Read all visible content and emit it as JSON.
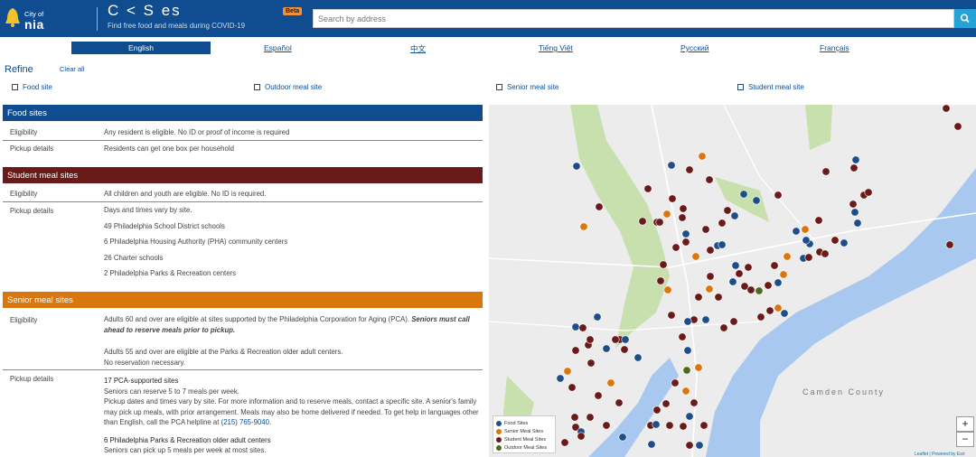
{
  "header": {
    "city_small": "City of",
    "city_big": "nia",
    "app_title": "C        <   S es",
    "beta": "Beta",
    "tagline": "Find free food and meals during COVID-19",
    "search_placeholder": "Search by address",
    "search_icon": "search-icon"
  },
  "languages": [
    "English",
    "Español",
    "中文",
    "Tiếng Việt",
    "Русский",
    "Français"
  ],
  "refine": {
    "title": "Refine",
    "clear_all": "Clear all",
    "filters": [
      "Food site",
      "Outdoor meal site",
      "Senior meal site",
      "Student meal site"
    ]
  },
  "sections": {
    "food": {
      "title": "Food sites",
      "color": "#0f4d90",
      "eligibility_label": "Eligibility",
      "eligibility": "Any resident is eligible. No ID or proof of income is required",
      "pickup_label": "Pickup details",
      "pickup": "Residents can get one box per household"
    },
    "student": {
      "title": "Student meal sites",
      "color": "#6b1a1a",
      "eligibility_label": "Eligibility",
      "eligibility": "All children and youth are eligible. No ID is required.",
      "pickup_label": "Pickup details",
      "pickup": [
        "Days and times vary by site.",
        "49 Philadelphia School District schools",
        "6 Philadelphia Housing Authority (PHA) community centers",
        "26 Charter schools",
        "2 Philadelphia Parks & Recreation centers"
      ]
    },
    "senior": {
      "title": "Senior meal sites",
      "color": "#d9770e",
      "eligibility_label": "Eligibility",
      "eligibility_1": "Adults 60 and over are eligible at sites supported by the Philadelphia Corporation for Aging (PCA). ",
      "eligibility_1_em": "Seniors must call ahead to reserve meals prior to pickup.",
      "eligibility_2": "Adults 55 and over are eligible at the Parks & Recreation older adult centers.",
      "eligibility_3": "No reservation necessary.",
      "pickup_label": "Pickup details",
      "pickup_h1": "17 PCA-supported sites",
      "pickup_p1": "Seniors can reserve 5 to 7 meals per week.",
      "pickup_p2": "Pickup dates and times vary by site. For more information and to reserve meals, contact a specific site. A senior's family may pick up meals, with prior arrangement. Meals may also be home delivered if needed. To get help in languages other than English, call the PCA helpline at ",
      "pickup_phone": "(215) 765-9040",
      "pickup_p2_end": ".",
      "pickup_h2": "6 Philadelphia Parks & Recreation older adult centers",
      "pickup_p3": "Seniors can pick up 5 meals per week at most sites."
    }
  },
  "map": {
    "label": "Camden County",
    "zoom_in": "+",
    "zoom_out": "−",
    "attribution": "Leaflet | Powered by Esri",
    "legend": [
      {
        "label": "Food Sites",
        "color": "#1d4e89"
      },
      {
        "label": "Senior Meal Sites",
        "color": "#d9770e"
      },
      {
        "label": "Student Meal Sites",
        "color": "#6b1a1a"
      },
      {
        "label": "Outdoor Meal Sites",
        "color": "#4a6b1f"
      }
    ],
    "colors": {
      "land": "#ececec",
      "water": "#a8c8f0",
      "park": "#c8dfae",
      "food": "#1d4e89",
      "senior": "#d9770e",
      "student": "#6b1a1a",
      "outdoor": "#4a6b1f"
    }
  }
}
